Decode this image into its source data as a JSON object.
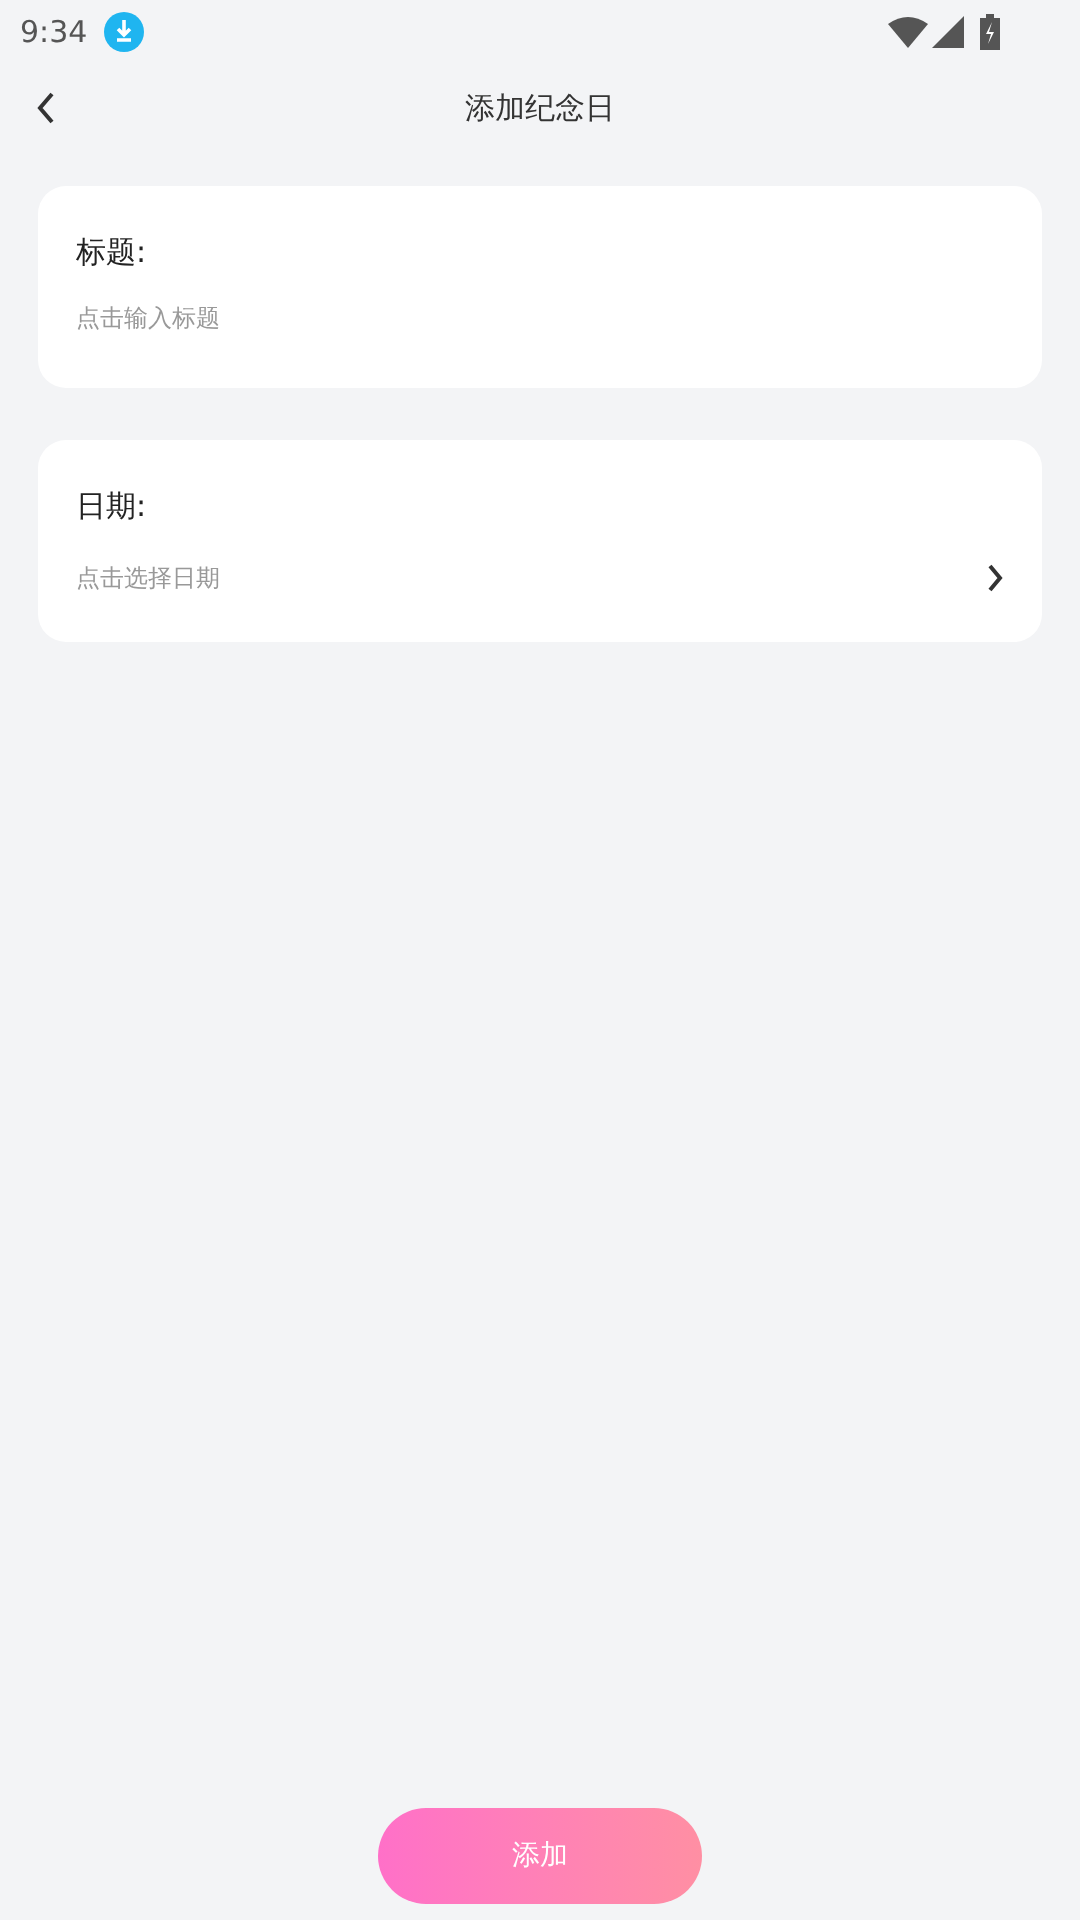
{
  "status_bar": {
    "time": "9:34"
  },
  "header": {
    "title": "添加纪念日"
  },
  "fields": [
    {
      "kind": "input",
      "label": "标题:",
      "placeholder": "点击输入标题"
    },
    {
      "kind": "picker",
      "label": "日期:",
      "placeholder": "点击选择日期"
    }
  ],
  "submit_button": {
    "label": "添加"
  }
}
